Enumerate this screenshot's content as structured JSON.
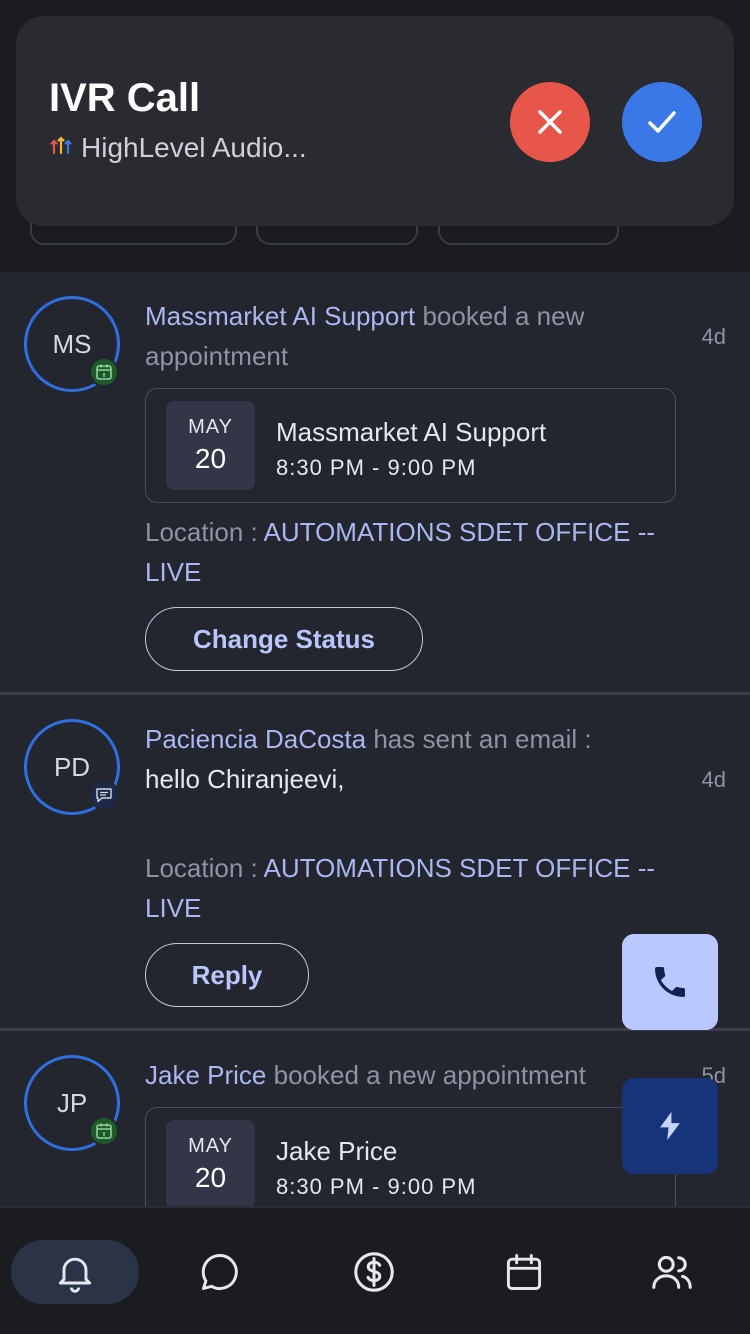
{
  "call_banner": {
    "title": "IVR Call",
    "subtitle": "HighLevel Audio..."
  },
  "feed": [
    {
      "initials": "MS",
      "badge": "calendar-icon",
      "actor": "Massmarket AI Support",
      "action": " booked a new appointment",
      "time": "4d",
      "appointment": {
        "month": "MAY",
        "day": "20",
        "name": "Massmarket AI Support",
        "time": "8:30 PM - 9:00 PM"
      },
      "location_label": "Location : ",
      "location_value": "AUTOMATIONS SDET OFFICE -- LIVE",
      "action_button": "Change Status"
    },
    {
      "initials": "PD",
      "badge": "message-icon",
      "actor": "Paciencia DaCosta",
      "action": " has sent an email :",
      "body": "hello Chiranjeevi,",
      "time": "4d",
      "location_label": "Location : ",
      "location_value": "AUTOMATIONS SDET OFFICE -- LIVE",
      "action_button": "Reply"
    },
    {
      "initials": "JP",
      "badge": "calendar-icon",
      "actor": "Jake Price",
      "action": " booked a new appointment",
      "time": "5d",
      "appointment": {
        "month": "MAY",
        "day": "20",
        "name": "Jake Price",
        "time": "8:30 PM - 9:00 PM"
      }
    }
  ],
  "bottom_nav": [
    {
      "icon": "bell-icon",
      "active": true
    },
    {
      "icon": "chat-bubble-icon",
      "active": false
    },
    {
      "icon": "dollar-icon",
      "active": false
    },
    {
      "icon": "calendar-icon",
      "active": false
    },
    {
      "icon": "contacts-icon",
      "active": false
    }
  ],
  "colors": {
    "accent": "#aab7f0",
    "decline": "#e8554a",
    "accept": "#3a78e8",
    "avatar_ring": "#2f6fe0"
  }
}
